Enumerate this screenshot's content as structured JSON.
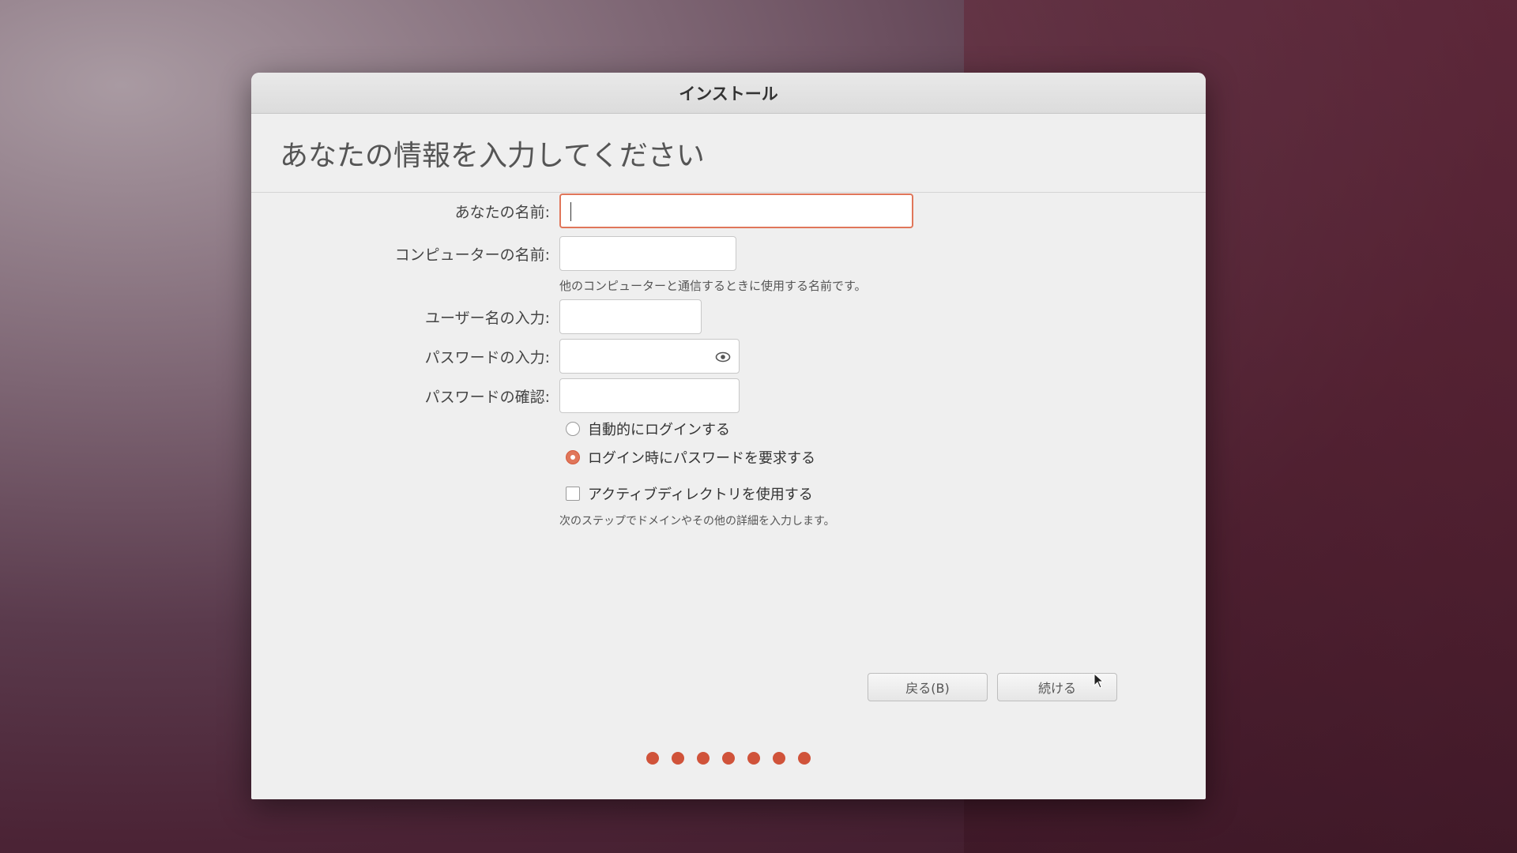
{
  "window": {
    "title": "インストール"
  },
  "page": {
    "heading": "あなたの情報を入力してください"
  },
  "form": {
    "your_name": {
      "label": "あなたの名前:",
      "value": ""
    },
    "computer_name": {
      "label": "コンピューターの名前:",
      "value": "",
      "hint": "他のコンピューターと通信するときに使用する名前です。"
    },
    "username": {
      "label": "ユーザー名の入力:",
      "value": ""
    },
    "password": {
      "label": "パスワードの入力:",
      "value": ""
    },
    "password_confirm": {
      "label": "パスワードの確認:",
      "value": ""
    },
    "login_options": [
      {
        "label": "自動的にログインする",
        "checked": false
      },
      {
        "label": "ログイン時にパスワードを要求する",
        "checked": true
      }
    ],
    "active_directory": {
      "label": "アクティブディレクトリを使用する",
      "checked": false,
      "hint": "次のステップでドメインやその他の詳細を入力します。"
    }
  },
  "buttons": {
    "back": "戻る(B)",
    "continue": "続ける"
  },
  "progress": {
    "steps": 7
  },
  "colors": {
    "accent": "#e0765a",
    "dot": "#d0533a"
  }
}
